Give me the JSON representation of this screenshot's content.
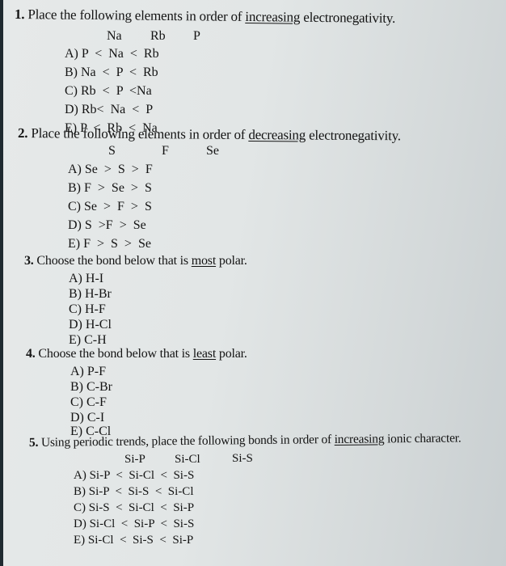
{
  "questions": [
    {
      "number": "1.",
      "stem_before": "Place the following elements in order of",
      "stem_emphasis": "increasing",
      "stem_after": "electronegativity.",
      "given": [
        "Na",
        "Rb",
        "P"
      ],
      "options": [
        "A) P  <  Na  <  Rb",
        "B) Na  <  P  <  Rb",
        "C) Rb  <  P  <Na",
        "D) Rb<  Na  <  P",
        "E) P  <  Rb  <  Na"
      ]
    },
    {
      "number": "2.",
      "stem_before": "Place the following elements in order of",
      "stem_emphasis": "decreasing",
      "stem_after": "electronegativity.",
      "given": [
        "S",
        "F",
        "Se"
      ],
      "options": [
        "A) Se  >  S  >  F",
        "B) F  >  Se  >  S",
        "C) Se  >  F  >  S",
        "D) S  >F  >  Se",
        "E) F  >  S  >  Se"
      ]
    },
    {
      "number": "3.",
      "stem_before": "Choose the bond below that is",
      "stem_emphasis": "most",
      "stem_after": "polar.",
      "given": [],
      "options": [
        "A) H-I",
        "B) H-Br",
        "C) H-F",
        "D) H-Cl",
        "E) C-H"
      ]
    },
    {
      "number": "4.",
      "stem_before": "Choose the bond below that is",
      "stem_emphasis": "least",
      "stem_after": "polar.",
      "given": [],
      "options": [
        "A) P-F",
        "B) C-Br",
        "C) C-F",
        "D) C-I",
        "E) C-Cl"
      ]
    },
    {
      "number": "5.",
      "stem_before": "Using periodic trends, place the following bonds in order of",
      "stem_emphasis": "increasing",
      "stem_after": "ionic character.",
      "given": [
        "Si-P",
        "Si-Cl",
        "Si-S"
      ],
      "options": [
        "A) Si-P  <  Si-Cl  <  Si-S",
        "B) Si-P  <  Si-S  <  Si-Cl",
        "C) Si-S  <  Si-Cl  <  Si-P",
        "D) Si-Cl  <  Si-P  <  Si-S",
        "E) Si-Cl  <  Si-S  <  Si-P"
      ]
    }
  ]
}
